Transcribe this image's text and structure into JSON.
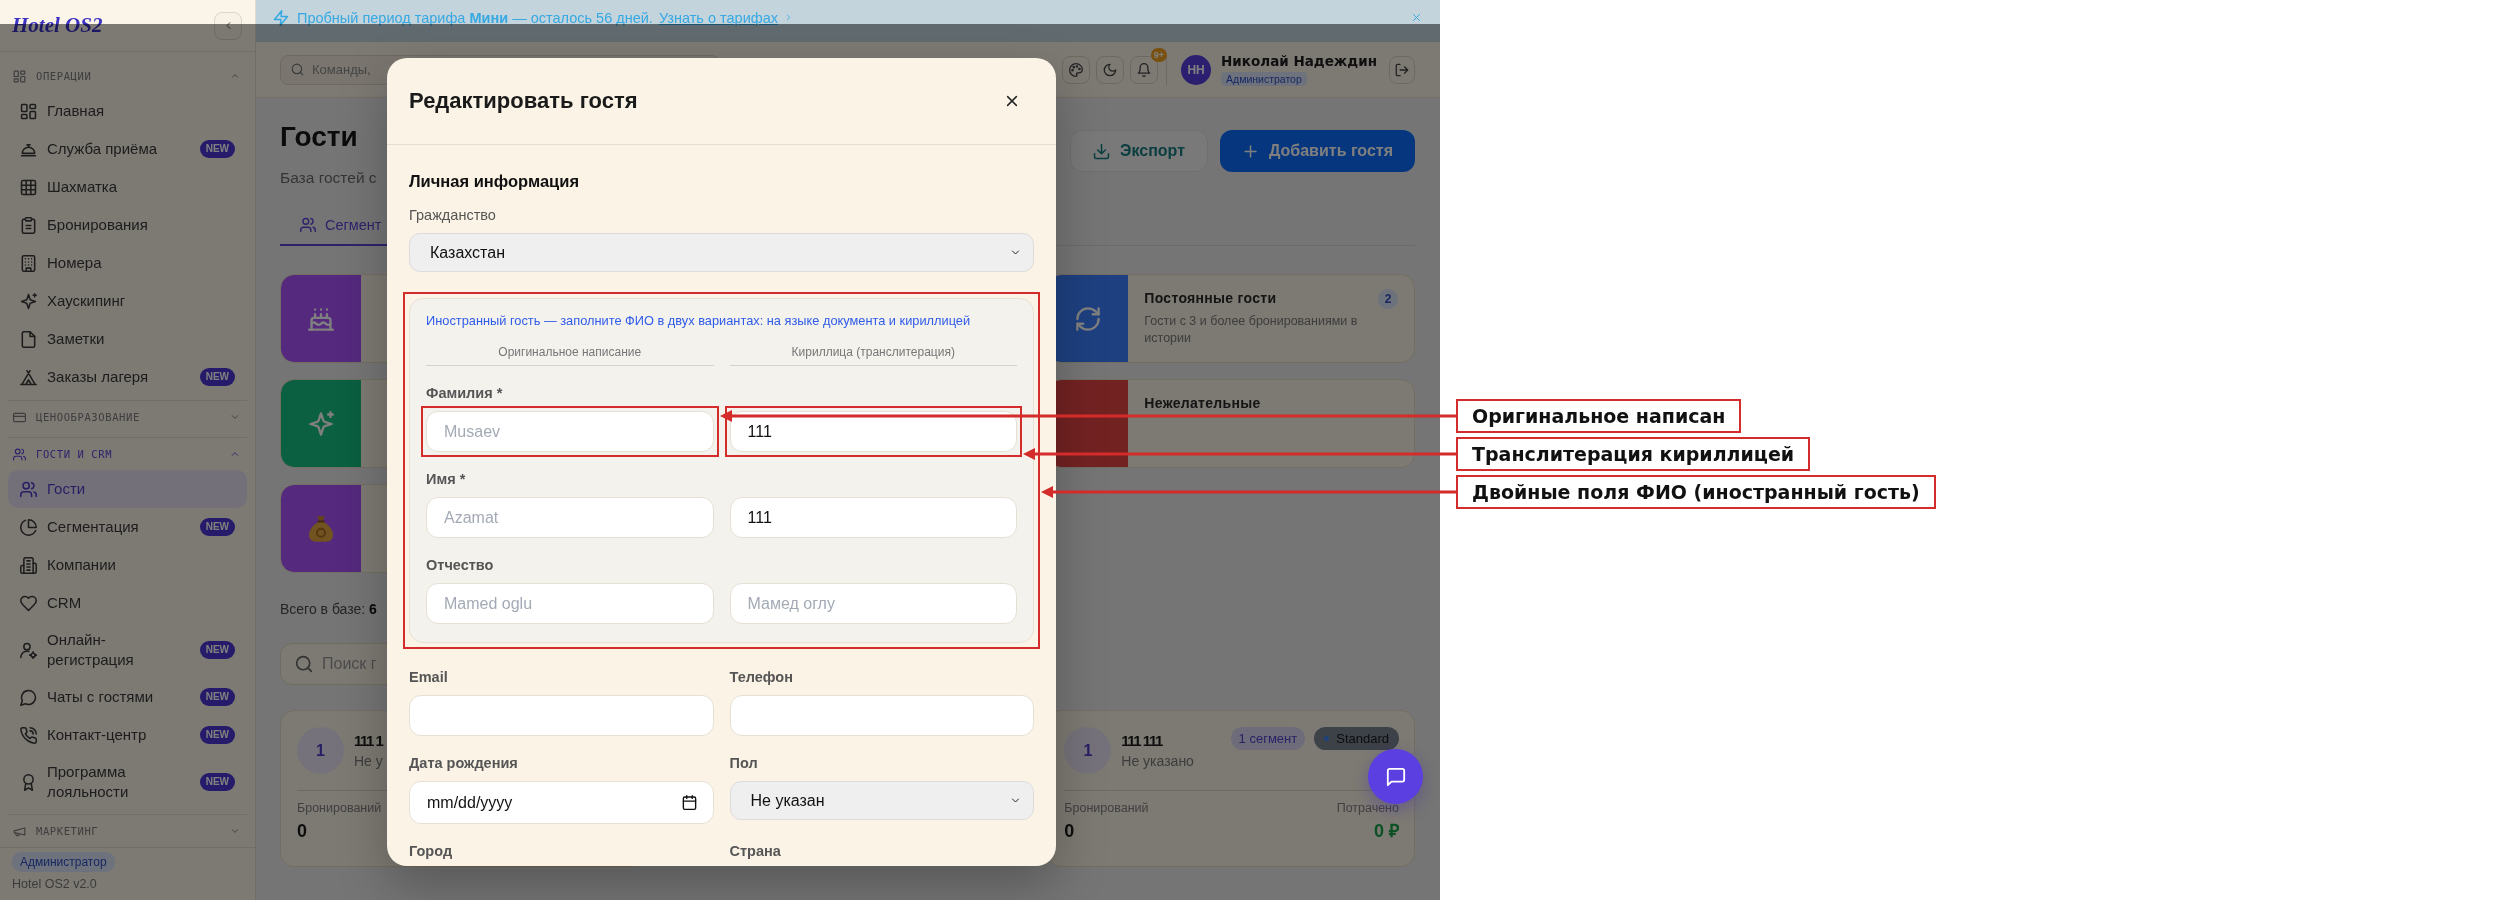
{
  "banner": {
    "text": "Пробный период тарифа **Мини** — осталось 56 дней.",
    "link": "Узнать о тарифах"
  },
  "sidebar": {
    "logo": "Hotel OS2",
    "sections": [
      {
        "title": "ОПЕРАЦИИ",
        "expanded": true,
        "items": [
          {
            "label": "Главная",
            "selected": false
          },
          {
            "label": "Служба приёма",
            "selected": false,
            "badge": "NEW"
          },
          {
            "label": "Шахматка",
            "selected": false
          },
          {
            "label": "Бронирования",
            "selected": false
          },
          {
            "label": "Номера",
            "selected": false
          },
          {
            "label": "Хаускипинг",
            "selected": false
          },
          {
            "label": "Заметки",
            "selected": false
          },
          {
            "label": "Заказы лагеря",
            "selected": false,
            "badge": "NEW"
          }
        ]
      },
      {
        "title": "ЦЕНООБРАЗОВАНИЕ",
        "expanded": false
      },
      {
        "title": "ГОСТИ И CRM",
        "expanded": true,
        "items": [
          {
            "label": "Гости",
            "selected": true
          },
          {
            "label": "Сегментация",
            "selected": false,
            "badge": "NEW"
          },
          {
            "label": "Компании",
            "selected": false
          },
          {
            "label": "CRM",
            "selected": false
          },
          {
            "label": "Онлайн-регистрация",
            "selected": false,
            "badge": "NEW"
          },
          {
            "label": "Чаты с гостями",
            "selected": false,
            "badge": "NEW"
          },
          {
            "label": "Контакт-центр",
            "selected": false,
            "badge": "NEW"
          },
          {
            "label": "Программа лояльности",
            "selected": false,
            "badge": "NEW"
          }
        ]
      },
      {
        "title": "МАРКЕТИНГ",
        "expanded": false
      }
    ],
    "footer": {
      "role": "Администратор",
      "version": "Hotel OS2 v2.0"
    }
  },
  "topbar": {
    "search": {
      "placeholder": "Команды,"
    },
    "notifications": "9+",
    "user": {
      "initials": "НН",
      "name": "Николай Надеждин",
      "role": "Администратор"
    }
  },
  "page": {
    "title": "Гости",
    "subtitle": "База гостей с",
    "actions": [
      {
        "label": "Экспорт",
        "kind": "secondary"
      },
      {
        "label": "Добавить гостя",
        "kind": "primary"
      }
    ],
    "tabs": [
      {
        "label": "Сегмент",
        "selected": true
      }
    ],
    "segments": {
      "left": [
        {
          "color": "#54297e"
        },
        {
          "color": "#0a6040"
        },
        {
          "color": "#54297e"
        }
      ],
      "right": [
        {
          "color": "#1e4080",
          "title": "Постоянные гости",
          "description": "Гости с 3 и более бронированиями в истории",
          "count": "2"
        },
        {
          "color": "#732222",
          "title": "Нежелательные"
        }
      ]
    },
    "total": "Всего в базе: **6**",
    "search": {
      "placeholder": "Поиск г"
    },
    "guests": {
      "left": [
        {
          "avatar": "1",
          "name": "111 1",
          "subtitle": "Не у",
          "stats": [
            {
              "label": "Бронирований",
              "value": "0",
              "kind": "count"
            }
          ]
        }
      ],
      "right": [
        {
          "avatar": "1",
          "name": "111 111",
          "subtitle": "Не указано",
          "chips": [
            {
              "label": "1 сегмент",
              "kind": "segment"
            },
            {
              "label": "Standard",
              "kind": "tier"
            }
          ],
          "stats": [
            {
              "label": "Бронирований",
              "value": "0",
              "kind": "count"
            },
            {
              "label": "Потрачено",
              "value": "0 ₽",
              "kind": "money"
            }
          ]
        }
      ]
    }
  },
  "modal": {
    "title": "Редактировать гостя",
    "section": "Личная информация",
    "citizenship": {
      "label": "Гражданство",
      "value": "Казахстан"
    },
    "foreign_name": {
      "note": "Иностранный гость — заполните ФИО в двух вариантах: на языке документа и кириллицей",
      "columns": [
        "Оригинальное написание",
        "Кириллица (транслитерация)"
      ],
      "annotation": "Двойные поля ФИО (иностранный гость)",
      "rows": [
        {
          "label": "Фамилия *",
          "original": {
            "placeholder": "Musaev",
            "annotation": "Оригинальное написан"
          },
          "cyrillic": {
            "value": "111",
            "annotation": "Транслитерация кириллицей"
          }
        },
        {
          "label": "Имя *",
          "original": {
            "placeholder": "Azamat"
          },
          "cyrillic": {
            "value": "111"
          }
        },
        {
          "label": "Отчество",
          "original": {
            "placeholder": "Mamed oglu"
          },
          "cyrillic": {
            "placeholder": "Мамед оглу"
          }
        }
      ]
    },
    "fields": [
      {
        "label": "Email",
        "kind": "text"
      },
      {
        "label": "Телефон",
        "kind": "text"
      },
      {
        "label": "Дата рождения",
        "kind": "date",
        "placeholder": "mm/dd/yyyy"
      },
      {
        "label": "Пол",
        "kind": "select",
        "value": "Не указан"
      },
      {
        "label": "Город"
      },
      {
        "label": "Страна"
      }
    ]
  }
}
